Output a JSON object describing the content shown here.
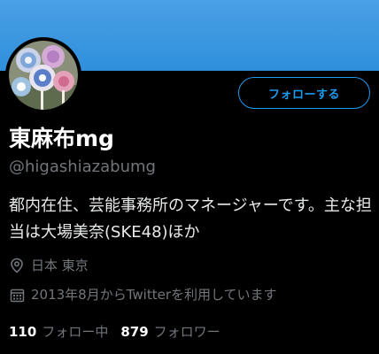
{
  "profile": {
    "display_name": "東麻布mg",
    "handle": "@higashiazabumg",
    "bio": "都内在住、芸能事務所のマネージャーです。主な担当は大場美奈(SKE48)ほか",
    "location": "日本 東京",
    "joined": "2013年8月からTwitterを利用しています",
    "avatar_icon": "candy-avatar"
  },
  "actions": {
    "follow_label": "フォローする"
  },
  "stats": {
    "following_count": "110",
    "following_label": "フォロー中",
    "followers_count": "879",
    "followers_label": "フォロワー"
  },
  "colors": {
    "banner": "#4aa0e4",
    "accent": "#1d9bf0",
    "background": "#000000",
    "secondary_text": "#71767b"
  }
}
